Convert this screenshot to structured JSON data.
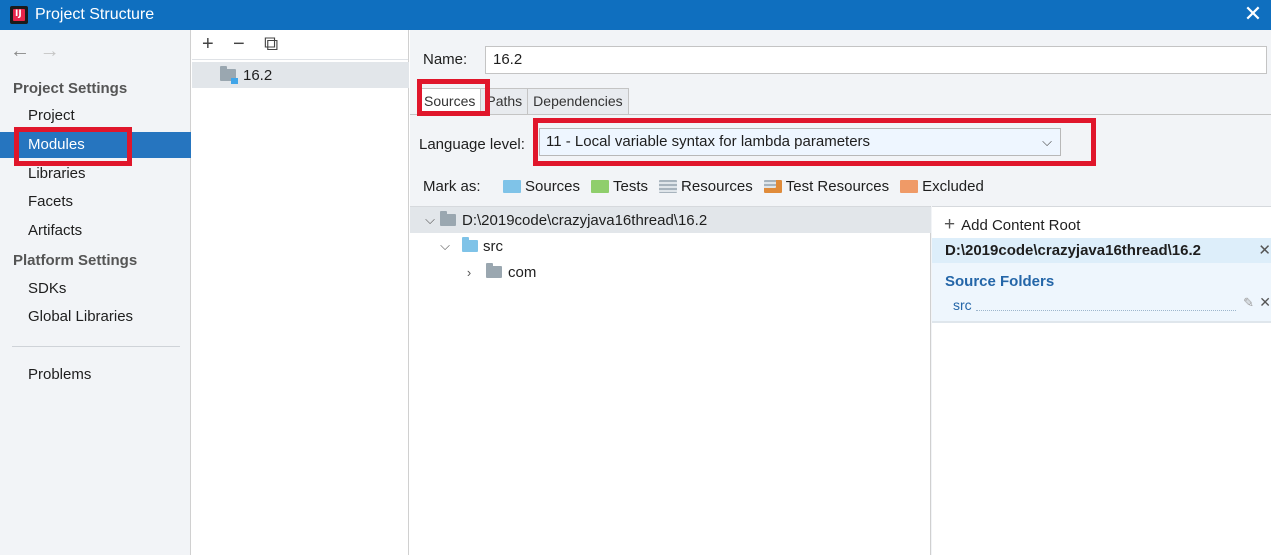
{
  "window": {
    "title": "Project Structure",
    "close_glyph": "✕"
  },
  "nav": {
    "back_glyph": "←",
    "forward_glyph": "→",
    "project_settings_title": "Project Settings",
    "project_settings_items": [
      "Project",
      "Modules",
      "Libraries",
      "Facets",
      "Artifacts"
    ],
    "platform_settings_title": "Platform Settings",
    "platform_settings_items": [
      "SDKs",
      "Global Libraries"
    ],
    "problems_label": "Problems",
    "selected": "Modules"
  },
  "modules": {
    "toolbar": {
      "add_glyph": "+",
      "remove_glyph": "−",
      "copy_glyph": "⧉"
    },
    "items": [
      "16.2"
    ]
  },
  "module_settings": {
    "name_label": "Name:",
    "name_value": "16.2",
    "tabs": [
      "Sources",
      "Paths",
      "Dependencies"
    ],
    "active_tab": "Sources",
    "language_level_label": "Language level:",
    "language_level_value": "11 - Local variable syntax for lambda parameters",
    "mark_as_label": "Mark as:",
    "mark_as_items": [
      {
        "label": "Sources",
        "icon": "sources-folder-icon"
      },
      {
        "label": "Tests",
        "icon": "tests-folder-icon"
      },
      {
        "label": "Resources",
        "icon": "resources-folder-icon"
      },
      {
        "label": "Test Resources",
        "icon": "test-resources-folder-icon"
      },
      {
        "label": "Excluded",
        "icon": "excluded-folder-icon"
      }
    ],
    "tree": {
      "root": "D:\\2019code\\crazyjava16thread\\16.2",
      "src": "src",
      "com": "com"
    },
    "content_roots": {
      "add_label": "Add Content Root",
      "root_path": "D:\\2019code\\crazyjava16thread\\16.2",
      "source_folders_title": "Source Folders",
      "source_folders": [
        "src"
      ]
    }
  },
  "colors": {
    "titlebar": "#0f6fbf",
    "selection": "#2675bf",
    "highlight_box": "#e0162b",
    "source_folder_text": "#2466a8"
  }
}
